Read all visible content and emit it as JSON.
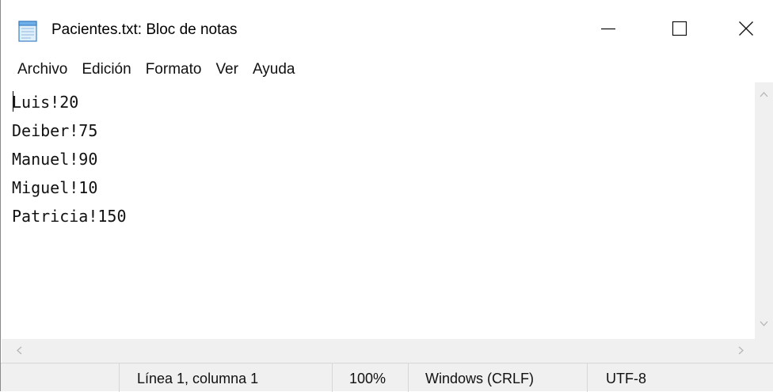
{
  "window": {
    "title": "Pacientes.txt: Bloc de notas",
    "app_icon": "notepad-icon",
    "controls": [
      "minimize-icon",
      "maximize-icon",
      "close-icon"
    ]
  },
  "menu": {
    "items": [
      "Archivo",
      "Edición",
      "Formato",
      "Ver",
      "Ayuda"
    ]
  },
  "editor": {
    "lines": [
      "Luis!20",
      "Deiber!75",
      "Manuel!90",
      "Miguel!10",
      "Patricia!150"
    ]
  },
  "statusbar": {
    "position": "Línea 1, columna 1",
    "zoom": "100%",
    "line_ending": "Windows (CRLF)",
    "encoding": "UTF-8"
  },
  "colors": {
    "background": "#ffffff",
    "chrome": "#f0f0f0",
    "text": "#111111"
  }
}
